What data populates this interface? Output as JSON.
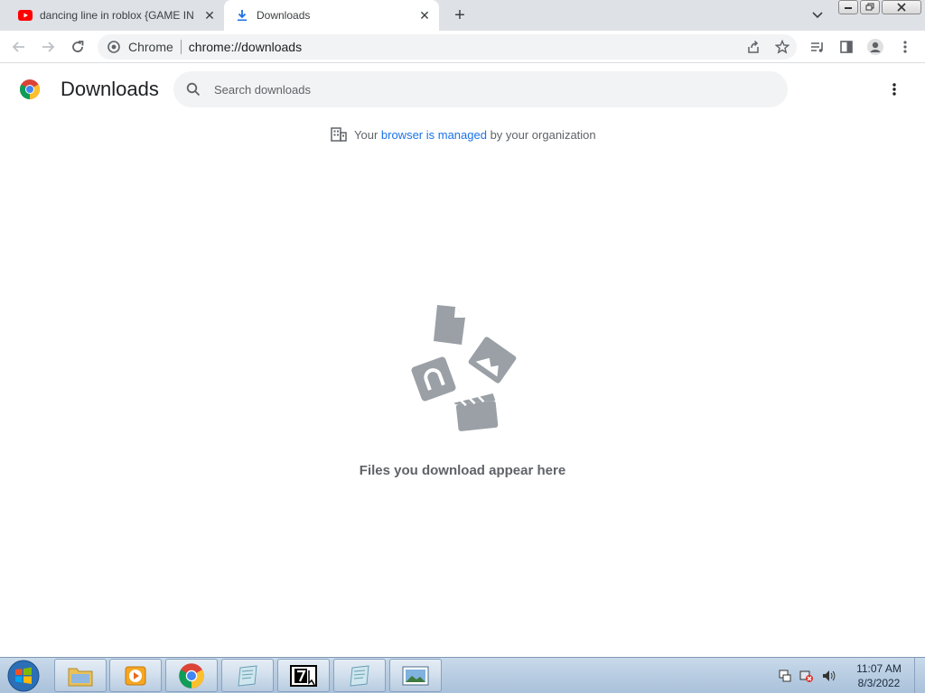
{
  "tabs": [
    {
      "title": "dancing line in roblox {GAME IN",
      "favicon": "youtube-icon",
      "active": false
    },
    {
      "title": "Downloads",
      "favicon": "download-icon",
      "active": true
    }
  ],
  "toolbar": {
    "site_chip": "Chrome",
    "url": "chrome://downloads"
  },
  "page": {
    "title": "Downloads",
    "search_placeholder": "Search downloads",
    "managed_prefix": "Your ",
    "managed_link": "browser is managed",
    "managed_suffix": " by your organization",
    "empty_message": "Files you download appear here"
  },
  "taskbar": {
    "apps": [
      "file-explorer",
      "media-player",
      "chrome",
      "notepad",
      "seven-zip",
      "notepad",
      "photo-viewer"
    ],
    "time": "11:07 AM",
    "date": "8/3/2022"
  },
  "colors": {
    "accent": "#1a73e8",
    "tabstrip": "#dee1e6",
    "illustration": "#9aa0a6"
  }
}
